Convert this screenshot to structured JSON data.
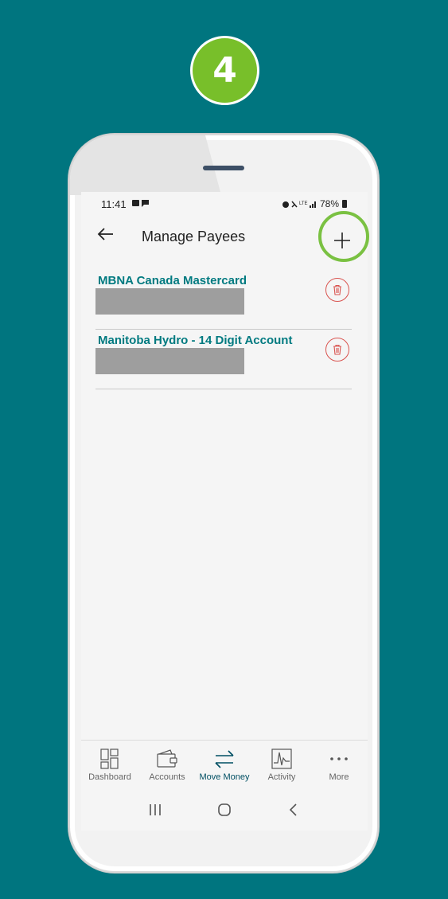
{
  "step": {
    "number": "4"
  },
  "status_bar": {
    "time": "11:41",
    "left_icons": "▣ ▪",
    "signal_text": "⏰ 🔇 ᴸᵀᴱ .ıl",
    "battery": "78%"
  },
  "header": {
    "title": "Manage Payees"
  },
  "payees": [
    {
      "name": "MBNA Canada Mastercard"
    },
    {
      "name": "Manitoba Hydro - 14 Digit Account"
    }
  ],
  "bottom_nav": {
    "items": [
      {
        "label": "Dashboard",
        "icon": "dashboard-icon"
      },
      {
        "label": "Accounts",
        "icon": "wallet-icon"
      },
      {
        "label": "Move Money",
        "icon": "transfer-arrows-icon"
      },
      {
        "label": "Activity",
        "icon": "activity-chart-icon"
      },
      {
        "label": "More",
        "icon": "more-dots-icon"
      }
    ],
    "active": "Move Money"
  },
  "colors": {
    "background": "#00757f",
    "accent": "#007a80",
    "highlight": "#7ac142",
    "delete": "#d9534f"
  }
}
